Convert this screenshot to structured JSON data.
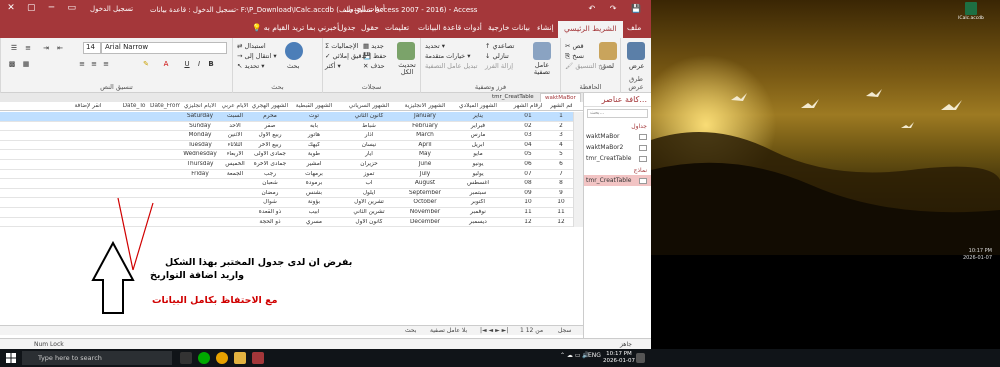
{
  "window": {
    "title": "تسجيل الدخول : قاعدة بيانات- F:\\P_Download\\ICalc.accdb (تنسيق ملف Access 2007 - 2016) - Access",
    "tools_label": "أدوات الجدول",
    "signin": "تسجيل الدخول",
    "qat": "↶ ↷ 💾"
  },
  "tabs": {
    "items": [
      "ملف",
      "الشريط الرئيسي",
      "إنشاء",
      "بيانات خارجية",
      "أدوات قاعدة البيانات",
      "تعليمات",
      "حقول",
      "جدول"
    ],
    "active": "الشريط الرئيسي",
    "tellme": "أخبرني بما تريد القيام به"
  },
  "ribbon": {
    "views": {
      "view": "عرض",
      "group": "طرق عرض"
    },
    "clipboard": {
      "paste": "لصق",
      "cut": "قص",
      "copy": "نسخ",
      "format_painter": "نسخ التنسيق",
      "group": "الحافظة"
    },
    "sort_filter": {
      "filter": "عامل تصفية",
      "ascending": "تصاعدي",
      "descending": "تنازلي",
      "remove_sort": "إزالة الفرز",
      "selection": "تحديد",
      "advanced": "خيارات متقدمة",
      "toggle": "تبديل عامل التصفية",
      "group": "فرز وتصفية"
    },
    "records": {
      "refresh": "تحديث الكل",
      "new": "جديد",
      "save": "حفظ",
      "delete": "حذف",
      "totals": "الإجماليات",
      "spelling": "تدقيق إملائي",
      "more": "أكثر",
      "group": "سجلات"
    },
    "find": {
      "find": "بحث",
      "replace": "استبدال",
      "goto": "انتقال إلى",
      "select": "تحديد",
      "group": "بحث"
    },
    "text_format": {
      "font": "Arial Narrow",
      "size": "14",
      "group": "تنسيق النص"
    }
  },
  "navpane": {
    "title": "كافة عناصر...",
    "search": "بحث...",
    "sections": [
      {
        "name": "جداول",
        "items": [
          "waktMaBor",
          "waktMaBor2",
          "tmr_CreatTable"
        ]
      },
      {
        "name": "نماذج",
        "items": [
          "tmr_CreatTable"
        ]
      }
    ],
    "selected": "tmr_CreatTable"
  },
  "doc_tabs": [
    "waktMaBor",
    "tmr_CreatTable"
  ],
  "grid": {
    "columns": [
      "رقم الشهر",
      "ارقام الشهر",
      "الشهور الميلادي",
      "الشهور الانجليزية",
      "الشهور السرياني",
      "الشهور القبطية",
      "الشهور الهجري",
      "الايام عربي",
      "الايام انجليزي",
      "Date_From",
      "Date_To",
      "انقر لإضافة"
    ],
    "rows": [
      [
        "1",
        "01",
        "يناير",
        "January",
        "كانون الثاني",
        "توت",
        "محرم",
        "السبت",
        "Saturday",
        "",
        ""
      ],
      [
        "2",
        "02",
        "فبراير",
        "February",
        "شباط",
        "بابه",
        "صفر",
        "الأحد",
        "Sunday",
        "",
        ""
      ],
      [
        "3",
        "03",
        "مارس",
        "March",
        "آذار",
        "هاتور",
        "ربيع الأول",
        "الاثنين",
        "Monday",
        "",
        ""
      ],
      [
        "4",
        "04",
        "أبريل",
        "April",
        "نيسان",
        "كيهك",
        "ربيع الآخر",
        "الثلاثاء",
        "Tuesday",
        "",
        ""
      ],
      [
        "5",
        "05",
        "مايو",
        "May",
        "أيار",
        "طوبة",
        "جمادى الأولى",
        "الأربعاء",
        "Wednesday",
        "",
        ""
      ],
      [
        "6",
        "06",
        "يونيو",
        "June",
        "حزيران",
        "امشير",
        "جمادى الآخرة",
        "الخميس",
        "Thursday",
        "",
        ""
      ],
      [
        "7",
        "07",
        "يوليو",
        "July",
        "تموز",
        "برمهات",
        "رجب",
        "الجمعة",
        "Friday",
        "",
        ""
      ],
      [
        "8",
        "08",
        "أغسطس",
        "August",
        "آب",
        "برمودة",
        "شعبان",
        "",
        "",
        "",
        ""
      ],
      [
        "9",
        "09",
        "سبتمبر",
        "September",
        "أيلول",
        "بشنس",
        "رمضان",
        "",
        "",
        "",
        ""
      ],
      [
        "10",
        "10",
        "أكتوبر",
        "October",
        "تشرين الأول",
        "بؤونة",
        "شوال",
        "",
        "",
        "",
        ""
      ],
      [
        "11",
        "11",
        "نوفمبر",
        "November",
        "تشرين الثاني",
        "أبيب",
        "ذو القعدة",
        "",
        "",
        "",
        ""
      ],
      [
        "12",
        "12",
        "ديسمبر",
        "December",
        "كانون الأول",
        "مسري",
        "ذو الحجة",
        "",
        "",
        "",
        ""
      ]
    ],
    "selected_row": 0
  },
  "record_nav": {
    "label": "سجل",
    "position": "1 من 12",
    "search": "بحث",
    "filter": "بلا عامل تصفية"
  },
  "statusbar": {
    "mode": "Num Lock",
    "ready": "جاهز"
  },
  "annotation": {
    "line1": "بفرض ان لدى جدول المختبر بهذا الشكل",
    "line2": "واريد اضافة التواريخ",
    "line3": "مع الاحتفاظ بكامل البيانات",
    "color_black": "#000000",
    "color_red": "#d00000"
  },
  "desktop": {
    "icon_label": "ICalc.accdb",
    "clock_time": "10:17 PM",
    "clock_date": "2026-01-07"
  },
  "taskbar": {
    "search_placeholder": "Type here to search",
    "lang": "ENG",
    "time": "10:17 PM",
    "date": "2026-01-07"
  }
}
